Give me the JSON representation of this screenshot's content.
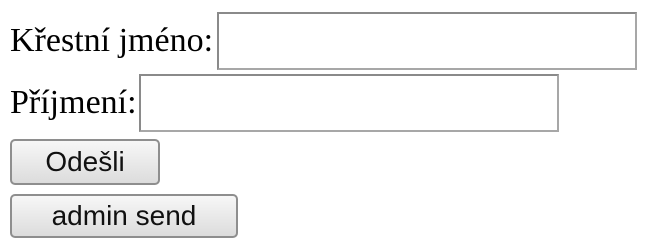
{
  "form": {
    "first_name_label": "Křestní jméno:",
    "first_name_value": "",
    "last_name_label": "Příjmení:",
    "last_name_value": "",
    "send_button_label": "Odešli",
    "admin_send_button_label": "admin send"
  }
}
